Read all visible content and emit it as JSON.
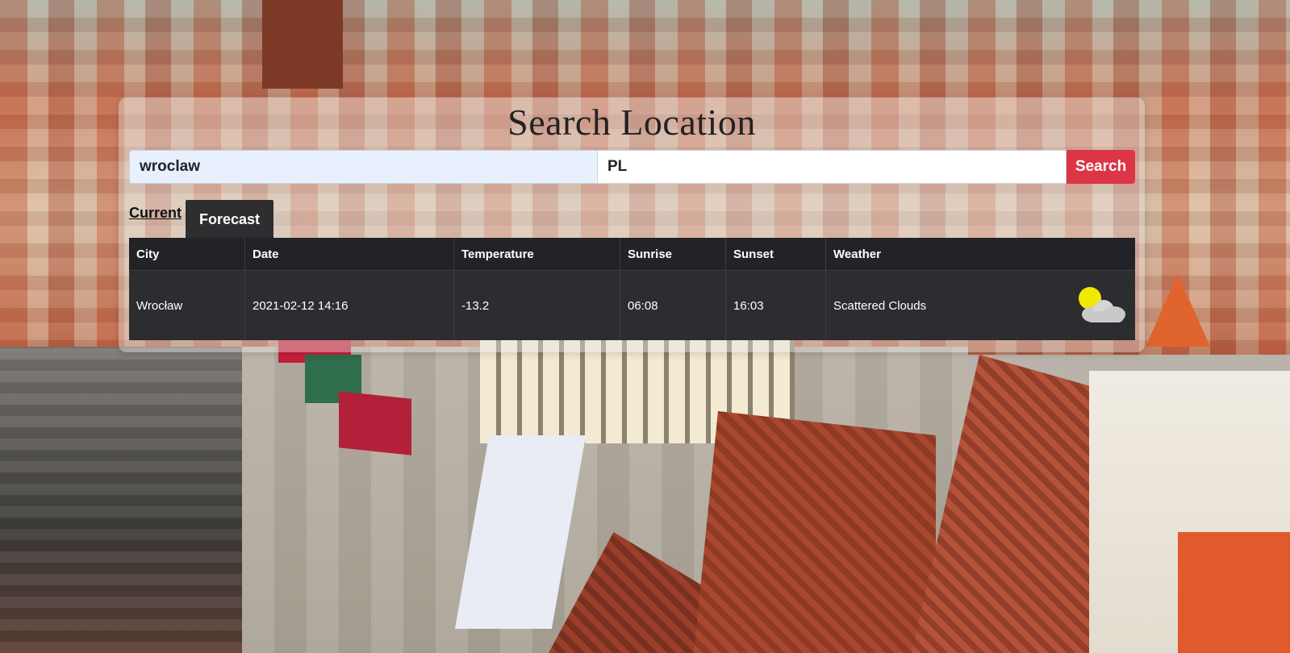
{
  "page": {
    "title": "Search Location"
  },
  "search": {
    "city_value": "wroclaw",
    "country_value": "PL",
    "button_label": "Search"
  },
  "tabs": [
    {
      "label": "Current",
      "active": true
    },
    {
      "label": "Forecast",
      "active": false
    }
  ],
  "table": {
    "headers": [
      "City",
      "Date",
      "Temperature",
      "Sunrise",
      "Sunset",
      "Weather"
    ],
    "rows": [
      {
        "city": "Wrocław",
        "date": "2021-02-12 14:16",
        "temperature": "-13.2",
        "sunrise": "06:08",
        "sunset": "16:03",
        "weather": "Scattered Clouds",
        "icon": "scattered-clouds-icon"
      }
    ]
  },
  "colors": {
    "search_button": "#dc3545",
    "table_bg": "#2b2c2f",
    "tab_active_bg": "#2e2e30"
  }
}
